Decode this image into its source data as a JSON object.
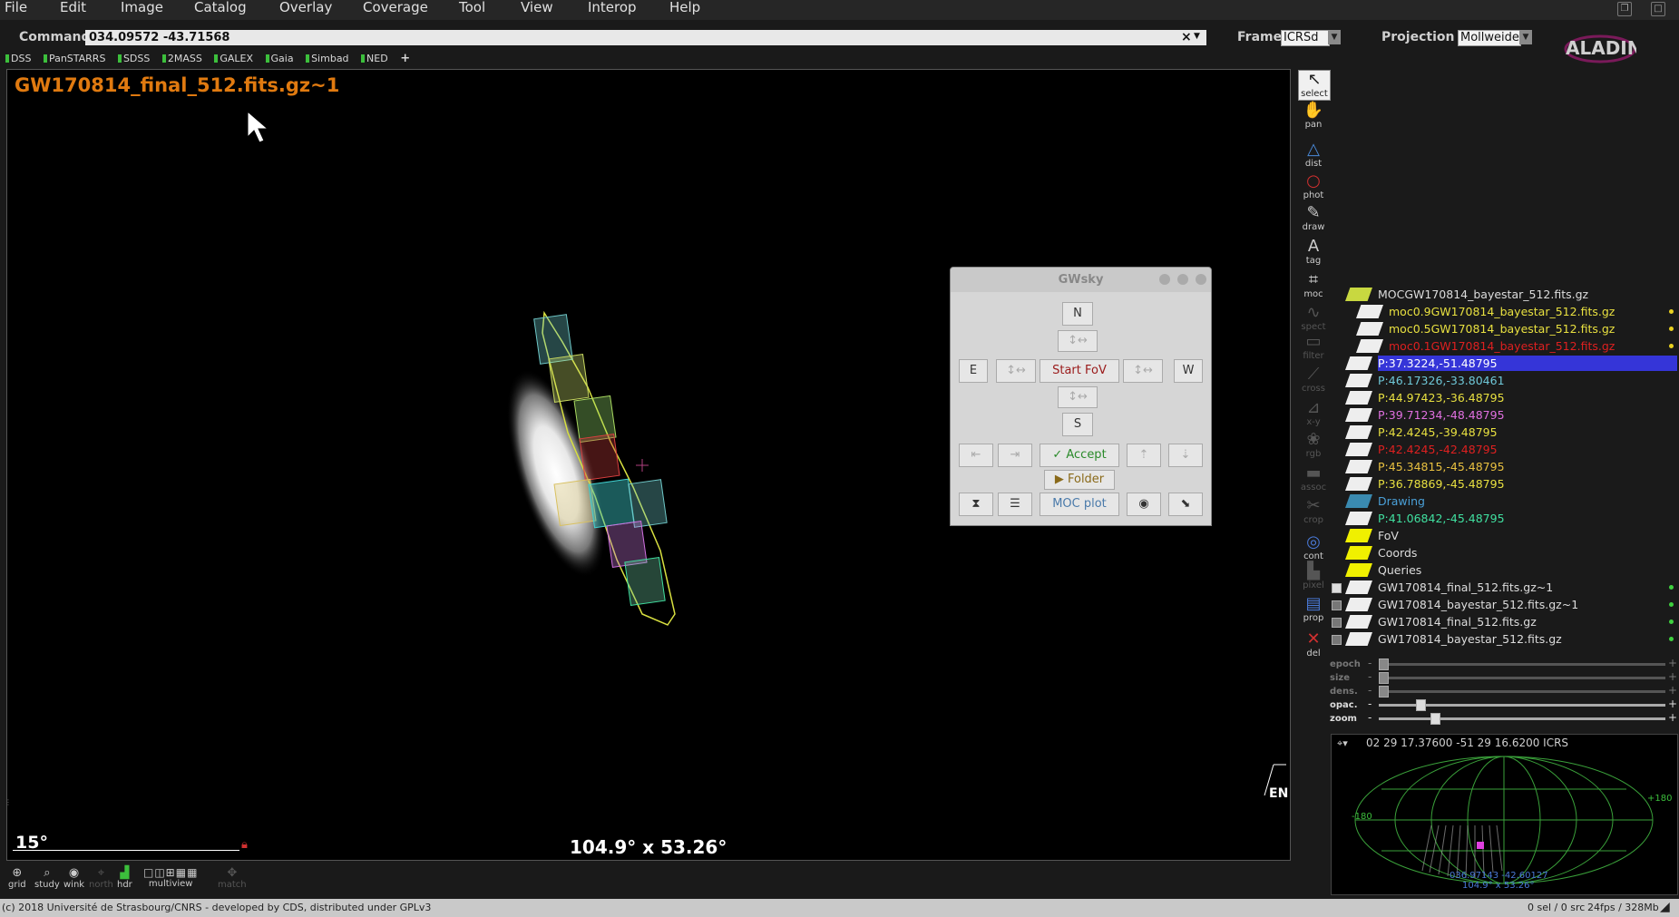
{
  "menu": [
    "File",
    "Edit",
    "Image",
    "Catalog",
    "Overlay",
    "Coverage",
    "Tool",
    "View",
    "Interop",
    "Help"
  ],
  "command": {
    "label": "Command",
    "value": "034.09572 -43.71568",
    "clear": "×"
  },
  "frame": {
    "label": "Frame",
    "value": "ICRSd"
  },
  "projection": {
    "label": "Projection",
    "value": "Mollweide"
  },
  "logo": "ALADIN",
  "servers": [
    "DSS",
    "PanSTARRS",
    "SDSS",
    "2MASS",
    "GALEX",
    "Gaia",
    "Simbad",
    "NED"
  ],
  "servers_add": "+",
  "view": {
    "title": "GW170814_final_512.fits.gz~1",
    "scale": "15°",
    "fov": "104.9° x 53.26°",
    "compass": "EN"
  },
  "tools": [
    {
      "name": "select",
      "label": "select",
      "icon": "↖"
    },
    {
      "name": "pan",
      "label": "pan",
      "icon": "✋"
    },
    {
      "name": "dist",
      "label": "dist",
      "icon": "△"
    },
    {
      "name": "phot",
      "label": "phot",
      "icon": "○"
    },
    {
      "name": "draw",
      "label": "draw",
      "icon": "✎"
    },
    {
      "name": "tag",
      "label": "tag",
      "icon": "A"
    },
    {
      "name": "moc",
      "label": "moc",
      "icon": "⌗"
    },
    {
      "name": "spect",
      "label": "spect",
      "icon": "∿"
    },
    {
      "name": "filter",
      "label": "filter",
      "icon": "▭"
    },
    {
      "name": "cross",
      "label": "cross",
      "icon": "⟋"
    },
    {
      "name": "xy",
      "label": "x-y",
      "icon": "⊿"
    },
    {
      "name": "rgb",
      "label": "rgb",
      "icon": "❀"
    },
    {
      "name": "assoc",
      "label": "assoc",
      "icon": "▬"
    },
    {
      "name": "crop",
      "label": "crop",
      "icon": "✂"
    },
    {
      "name": "cont",
      "label": "cont",
      "icon": "◎"
    },
    {
      "name": "pixel",
      "label": "pixel",
      "icon": "▙"
    },
    {
      "name": "prop",
      "label": "prop",
      "icon": "▤"
    },
    {
      "name": "del",
      "label": "del",
      "icon": "✕"
    }
  ],
  "bottom_tools": [
    "grid",
    "study",
    "wink",
    "north",
    "hdr",
    "multiview",
    "match"
  ],
  "gwsky": {
    "title": "GWsky",
    "n": "N",
    "s": "S",
    "e": "E",
    "w": "W",
    "arrows": "↕↔",
    "start": "Start FoV",
    "accept": "✓ Accept",
    "folder": "▶ Folder",
    "mocplot": "MOC plot",
    "left": "⇤",
    "right": "⇥",
    "up": "⇡",
    "down": "⇣",
    "hourglass": "⧗",
    "list": "☰",
    "circle": "◉",
    "diag": "⬊"
  },
  "layers": [
    {
      "label": "MOCGW170814_bayestar_512.fits.gz",
      "color": "#dddddd"
    },
    {
      "label": "moc0.9GW170814_bayestar_512.fits.gz",
      "color": "#e8e040"
    },
    {
      "label": "moc0.5GW170814_bayestar_512.fits.gz",
      "color": "#e8e040"
    },
    {
      "label": "moc0.1GW170814_bayestar_512.fits.gz",
      "color": "#dd2020"
    },
    {
      "label": "P:37.3224,-51.48795",
      "color": "#ffffff"
    },
    {
      "label": "P:46.17326,-33.80461",
      "color": "#6fc8d8"
    },
    {
      "label": "P:44.97423,-36.48795",
      "color": "#e8e040"
    },
    {
      "label": "P:39.71234,-48.48795",
      "color": "#e070e0"
    },
    {
      "label": "P:42.4245,-39.48795",
      "color": "#e8e040"
    },
    {
      "label": "P:42.4245,-42.48795",
      "color": "#dd2020"
    },
    {
      "label": "P:45.34815,-45.48795",
      "color": "#e8c040"
    },
    {
      "label": "P:36.78869,-45.48795",
      "color": "#e8e040"
    },
    {
      "label": "Drawing",
      "color": "#4aa0d8"
    },
    {
      "label": "P:41.06842,-45.48795",
      "color": "#40e0a0"
    },
    {
      "label": "FoV",
      "color": "#dddddd"
    },
    {
      "label": "Coords",
      "color": "#dddddd"
    },
    {
      "label": "Queries",
      "color": "#dddddd"
    },
    {
      "label": "GW170814_final_512.fits.gz~1",
      "color": "#dddddd"
    },
    {
      "label": "GW170814_bayestar_512.fits.gz~1",
      "color": "#dddddd"
    },
    {
      "label": "GW170814_final_512.fits.gz",
      "color": "#dddddd"
    },
    {
      "label": "GW170814_bayestar_512.fits.gz",
      "color": "#dddddd"
    }
  ],
  "sliders": [
    {
      "label": "epoch",
      "active": false,
      "level": 0.0
    },
    {
      "label": "size",
      "active": false,
      "level": 0.0
    },
    {
      "label": "dens.",
      "active": false,
      "level": 0.0
    },
    {
      "label": "opac.",
      "active": true,
      "level": 0.13
    },
    {
      "label": "zoom",
      "active": true,
      "level": 0.18
    }
  ],
  "mini": {
    "coords": "02 29 17.37600 -51 29 16.6200 ICRS",
    "left": "-180",
    "right": "+180",
    "center": "036.97143 -42.60127",
    "fov": "104.9° x 53.26°"
  },
  "status": {
    "left": "(c) 2018 Université de Strasbourg/CNRS - developed by CDS, distributed under GPLv3",
    "sel": "0 sel / 0 src",
    "mem": "24fps / 328Mb"
  },
  "colors": {
    "title": "#e07a10",
    "selected_layer": "#3535d8",
    "moc09": "#e8e040",
    "moc01": "#dd2020"
  }
}
